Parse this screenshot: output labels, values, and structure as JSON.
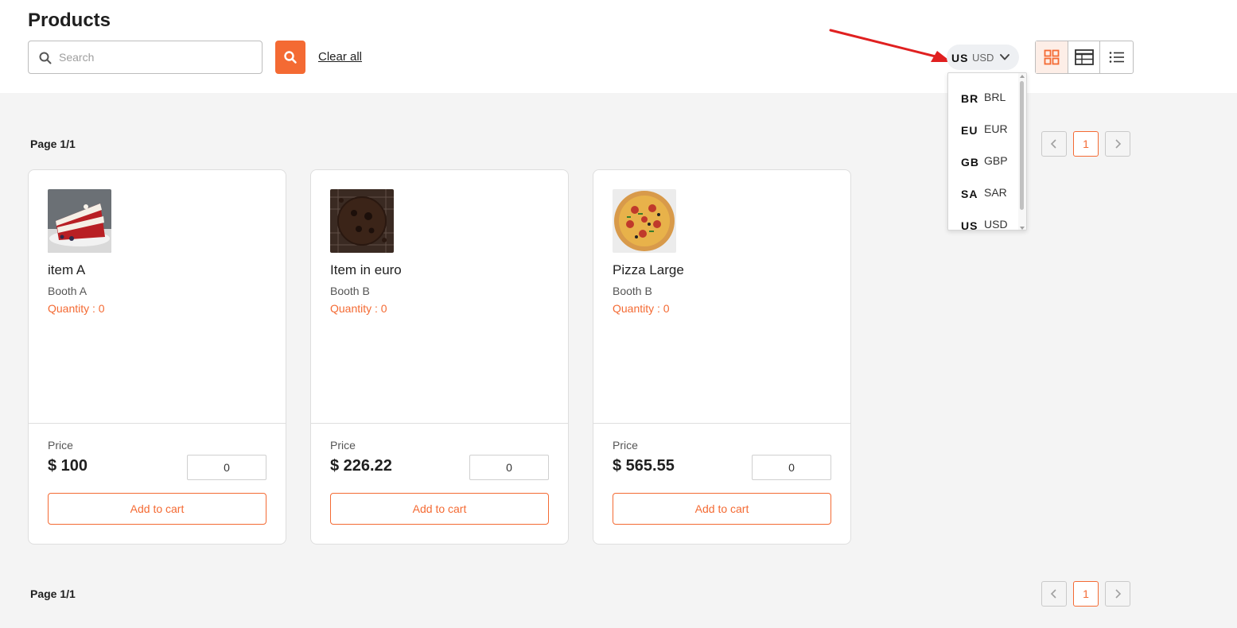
{
  "header": {
    "title": "Products",
    "search_placeholder": "Search",
    "clear_all": "Clear all"
  },
  "currency": {
    "selected_flag": "US",
    "selected_code": "USD",
    "options": [
      {
        "flag": "BR",
        "code": "BRL"
      },
      {
        "flag": "EU",
        "code": "EUR"
      },
      {
        "flag": "GB",
        "code": "GBP"
      },
      {
        "flag": "SA",
        "code": "SAR"
      },
      {
        "flag": "US",
        "code": "USD"
      }
    ]
  },
  "view_toggle": {
    "active": "grid",
    "options": [
      "grid-view-icon",
      "table-view-icon",
      "list-view-icon"
    ]
  },
  "pagination": {
    "label": "Page 1/1",
    "current_page": "1"
  },
  "products": [
    {
      "name": "item A",
      "booth": "Booth A",
      "quantity": "Quantity : 0",
      "price_label": "Price",
      "price": "$ 100",
      "qty_value": "0",
      "add_label": "Add to cart",
      "image": "red-velvet-cake"
    },
    {
      "name": "Item in euro",
      "booth": "Booth B",
      "quantity": "Quantity : 0",
      "price_label": "Price",
      "price": "$ 226.22",
      "qty_value": "0",
      "add_label": "Add to cart",
      "image": "chocolate-cookie"
    },
    {
      "name": "Pizza Large",
      "booth": "Booth B",
      "quantity": "Quantity : 0",
      "price_label": "Price",
      "price": "$ 565.55",
      "qty_value": "0",
      "add_label": "Add to cart",
      "image": "pizza"
    }
  ],
  "colors": {
    "accent": "#f46a33",
    "annotation_arrow": "#e02020",
    "background": "#f4f4f4"
  }
}
